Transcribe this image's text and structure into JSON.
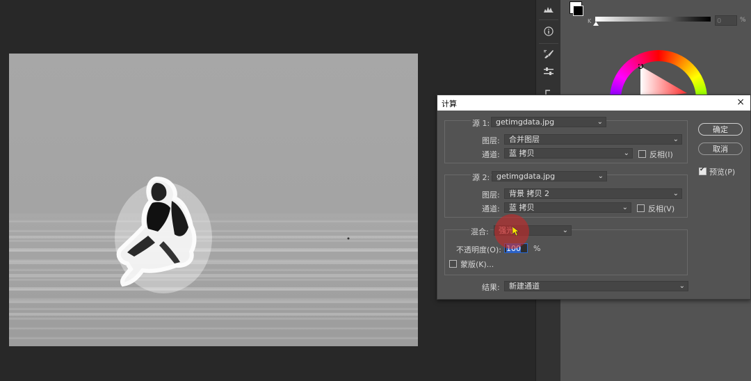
{
  "right_panel": {
    "color_slider_label": "K",
    "color_value": "0",
    "color_unit": "%"
  },
  "dialog": {
    "title": "计算",
    "close_label": "×",
    "source1": {
      "label": "源 1:",
      "file": "getimgdata.jpg",
      "layer_label": "图层:",
      "layer": "合并图层",
      "channel_label": "通道:",
      "channel": "蓝 拷贝",
      "invert_label": "反相(I)",
      "invert_checked": false
    },
    "source2": {
      "label": "源 2:",
      "file": "getimgdata.jpg",
      "layer_label": "图层:",
      "layer": "背景 拷贝 2",
      "channel_label": "通道:",
      "channel": "蓝 拷贝",
      "invert_label": "反相(V)",
      "invert_checked": false
    },
    "blending": {
      "label": "混合:",
      "mode": "强光",
      "opacity_label": "不透明度(O):",
      "opacity": "100",
      "opacity_unit": "%",
      "mask_label": "蒙版(K)...",
      "mask_checked": false
    },
    "result": {
      "label": "结果:",
      "value": "新建通道"
    },
    "buttons": {
      "ok": "确定",
      "cancel": "取消",
      "preview_label": "预览(P)",
      "preview_checked": true
    }
  },
  "colors": {
    "panel_bg": "#535353",
    "canvas_bg": "#282828",
    "toolbar_bg": "#323232",
    "selection_blue": "#2b62c7",
    "cursor_highlight": "#c82828"
  },
  "icons": [
    "histogram-icon",
    "info-icon",
    "brush-settings-icon",
    "adjust-icon",
    "history-icon"
  ]
}
